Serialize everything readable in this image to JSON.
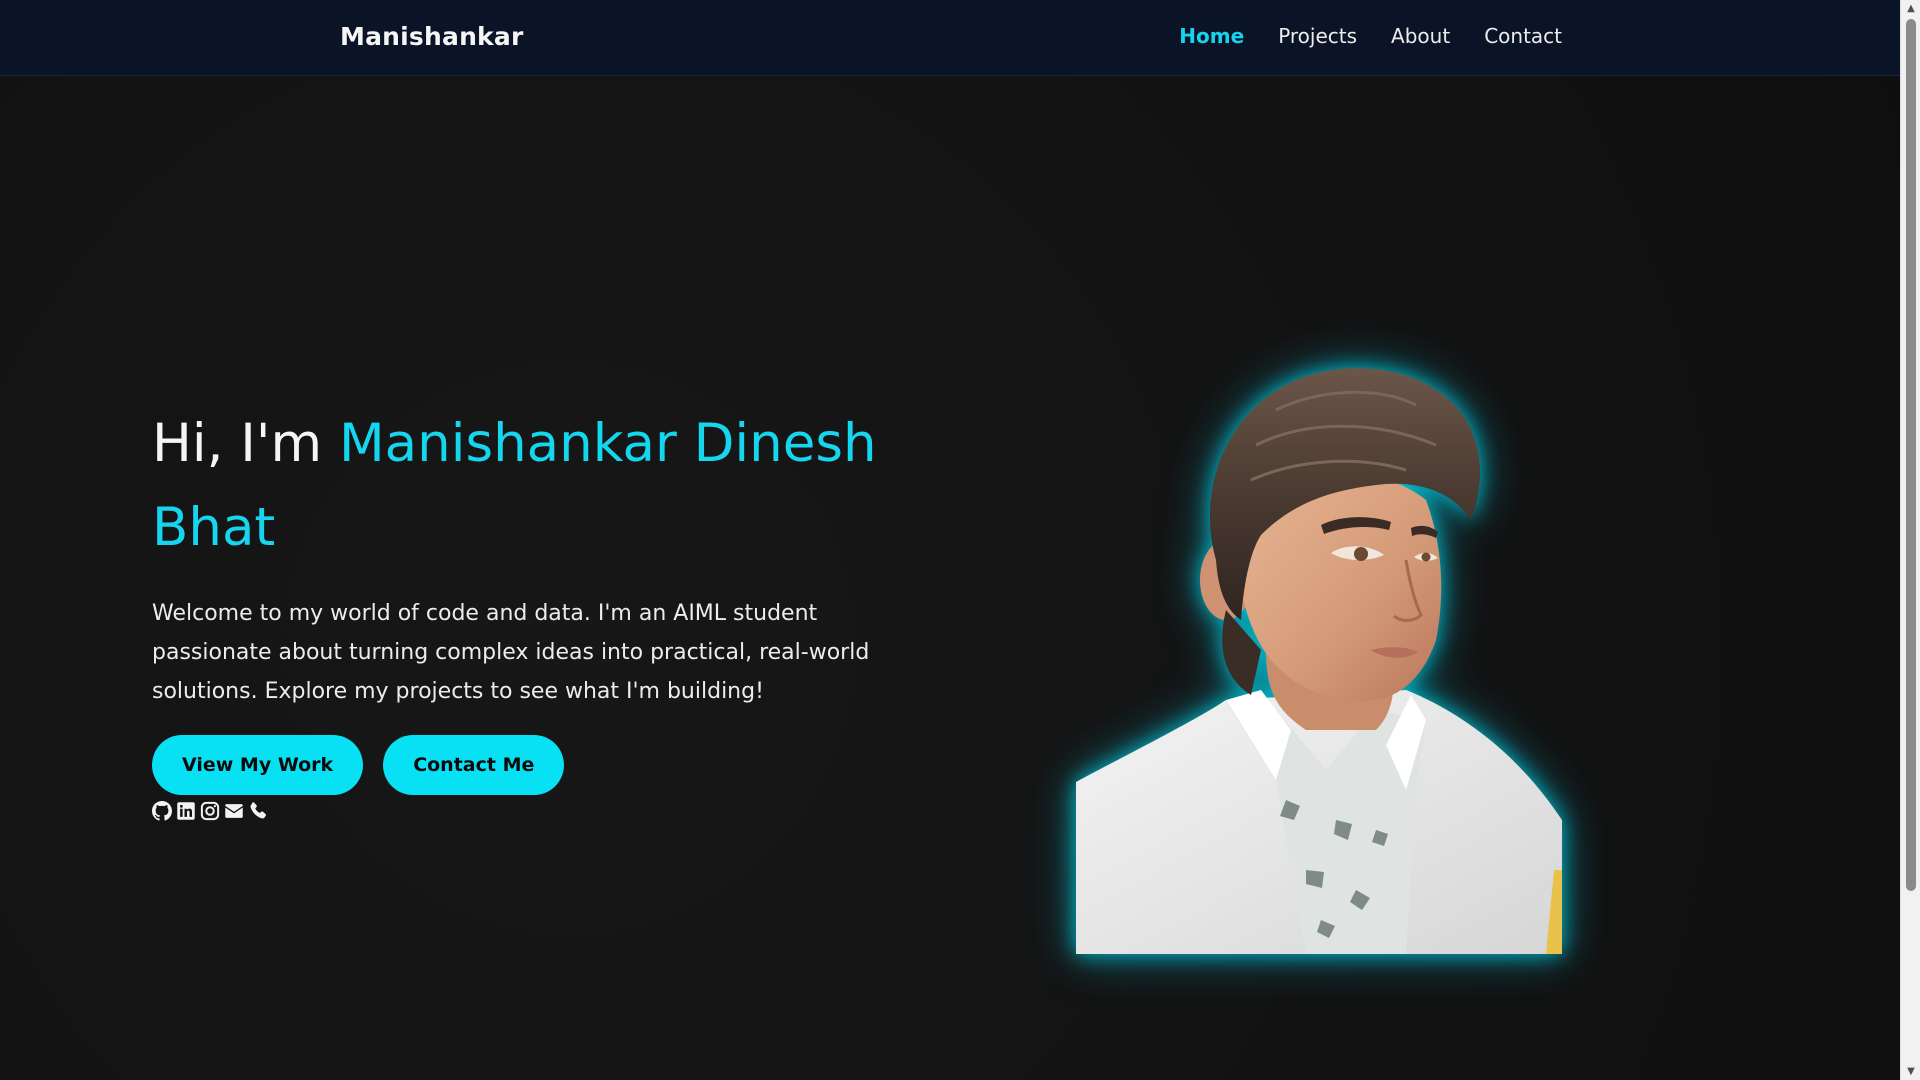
{
  "navbar": {
    "brand": "Manishankar",
    "links": [
      {
        "label": "Home",
        "active": true
      },
      {
        "label": "Projects",
        "active": false
      },
      {
        "label": "About",
        "active": false
      },
      {
        "label": "Contact",
        "active": false
      }
    ]
  },
  "hero": {
    "greeting": "Hi, I'm ",
    "name": "Manishankar Dinesh Bhat",
    "description": "Welcome to my world of code and data. I'm an AIML student passionate about turning complex ideas into practical, real-world solutions. Explore my projects to see what I'm building!",
    "buttons": {
      "primary_label": "View My Work",
      "secondary_label": "Contact Me"
    },
    "socials": [
      "github-icon",
      "linkedin-icon",
      "instagram-icon",
      "email-icon",
      "phone-icon"
    ]
  },
  "colors": {
    "accent": "#16d6ef",
    "button_bg": "#08e0f4",
    "navbar_bg": "#0b1426",
    "page_bg": "#121212"
  }
}
